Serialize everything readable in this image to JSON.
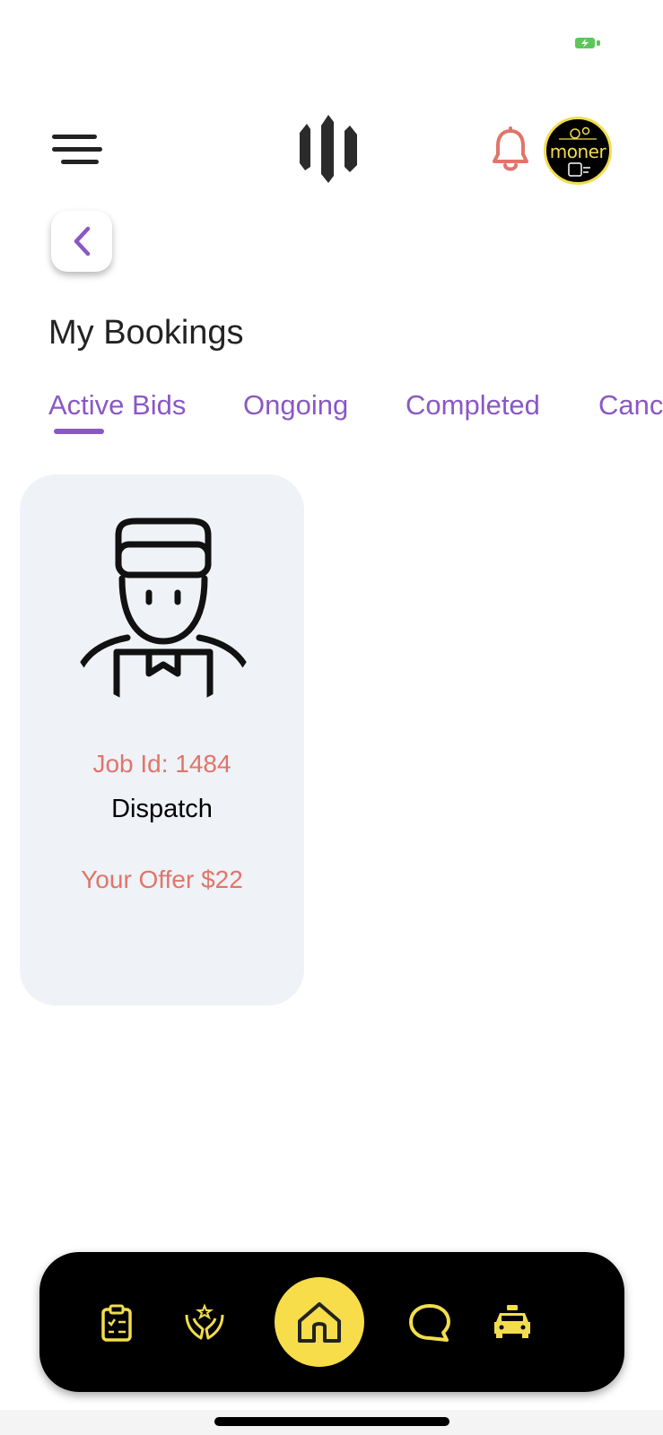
{
  "header": {
    "avatar_text": "moner"
  },
  "page": {
    "title": "My Bookings"
  },
  "tabs": [
    {
      "label": "Active Bids",
      "active": true
    },
    {
      "label": "Ongoing",
      "active": false
    },
    {
      "label": "Completed",
      "active": false
    },
    {
      "label": "Cancelled",
      "active": false
    }
  ],
  "bookings": [
    {
      "job_id": "Job Id: 1484",
      "type": "Dispatch",
      "offer": "Your Offer $22"
    }
  ],
  "nav": {
    "items": [
      "clipboard-icon",
      "hands-star-icon",
      "home-icon",
      "chat-icon",
      "taxi-icon"
    ]
  },
  "colors": {
    "accent_purple": "#8a58c4",
    "coral": "#e0756a",
    "nav_yellow": "#f7dd4a",
    "card_bg": "#eff2f7"
  }
}
